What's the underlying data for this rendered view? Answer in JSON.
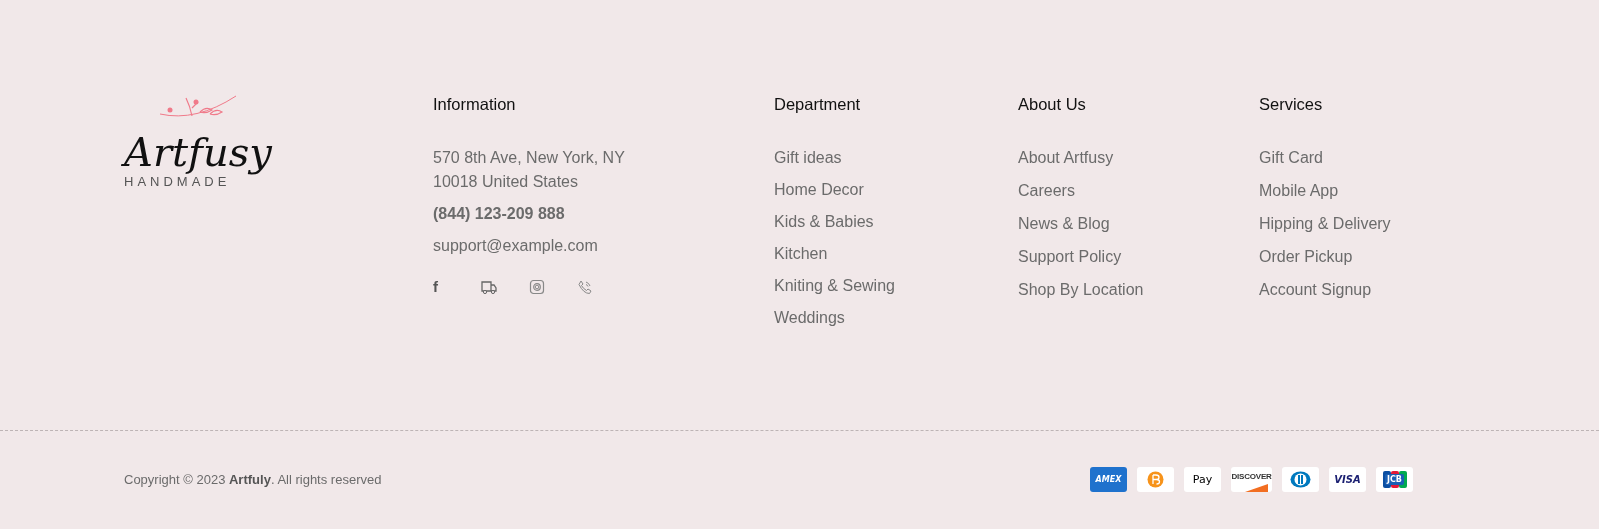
{
  "logo": {
    "wordmark": "Artfusy",
    "tagline": "HANDMADE"
  },
  "information": {
    "title": "Information",
    "address": [
      "570 8th Ave, New York, NY",
      "10018 United States"
    ],
    "phone": "(844) 123-209 888",
    "email": "support@example.com",
    "social": [
      {
        "kind": "facebook",
        "label": "f"
      },
      {
        "kind": "truck"
      },
      {
        "kind": "instagram"
      },
      {
        "kind": "phone"
      }
    ]
  },
  "columns": [
    {
      "title": "Department",
      "links": [
        "Gift ideas",
        "Home Decor",
        "Kids & Babies",
        "Kitchen",
        "Kniting & Sewing",
        "Weddings"
      ]
    },
    {
      "title": "About Us",
      "links": [
        "About Artfusy",
        "Careers",
        "News & Blog",
        "Support Policy",
        "Shop By Location"
      ]
    },
    {
      "title": "Services",
      "links": [
        "Gift Card",
        "Mobile App",
        "Hipping & Delivery",
        "Order Pickup",
        "Account Signup"
      ]
    }
  ],
  "copyright": "Copyright © 2023 **Artfuly**. All rights reserved",
  "payments": [
    {
      "kind": "amex",
      "label": "AMEX"
    },
    {
      "kind": "bitcoin"
    },
    {
      "kind": "applepay",
      "label": "Pay"
    },
    {
      "kind": "discover",
      "label": "DISCOVER"
    },
    {
      "kind": "diners"
    },
    {
      "kind": "visa",
      "label": "VISA"
    },
    {
      "kind": "jcb",
      "label": "JCB"
    }
  ]
}
